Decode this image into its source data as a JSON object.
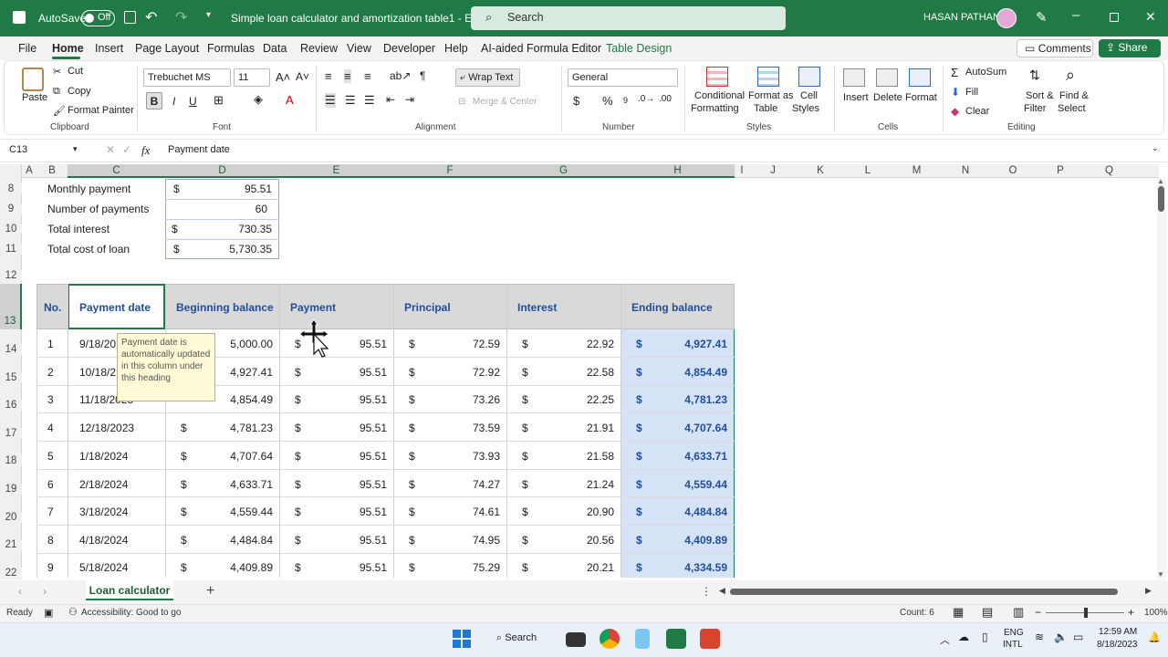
{
  "titlebar": {
    "autosave_label": "AutoSave",
    "autosave_state": "Off",
    "doc_title": "Simple loan calculator and amortization table1 - E...",
    "search_label": "Search",
    "user_name": "HASAN PATHAN"
  },
  "menu": {
    "tabs": [
      "File",
      "Home",
      "Insert",
      "Page Layout",
      "Formulas",
      "Data",
      "Review",
      "View",
      "Developer",
      "Help",
      "AI-aided Formula Editor",
      "Table Design"
    ],
    "comments_label": "Comments",
    "share_label": "Share"
  },
  "ribbon": {
    "clipboard": {
      "paste": "Paste",
      "cut": "Cut",
      "copy": "Copy",
      "format_painter": "Format Painter",
      "group": "Clipboard"
    },
    "font": {
      "name": "Trebuchet MS",
      "size": "11",
      "bold": "B",
      "italic": "I",
      "underline": "U",
      "group": "Font"
    },
    "alignment": {
      "wrap_text": "Wrap Text",
      "merge_center": "Merge & Center",
      "group": "Alignment"
    },
    "number": {
      "format": "General",
      "currency": "$",
      "percent": "%",
      "group": "Number"
    },
    "styles": {
      "conditional_1": "Conditional",
      "conditional_2": "Formatting",
      "format_table_1": "Format as",
      "format_table_2": "Table",
      "cell_styles_1": "Cell",
      "cell_styles_2": "Styles",
      "group": "Styles"
    },
    "cells": {
      "insert": "Insert",
      "delete": "Delete",
      "format": "Format",
      "group": "Cells"
    },
    "editing": {
      "autosum": "AutoSum",
      "fill": "Fill",
      "clear": "Clear",
      "sort_1": "Sort &",
      "sort_2": "Filter",
      "find_1": "Find &",
      "find_2": "Select",
      "group": "Editing"
    }
  },
  "formula_bar": {
    "name_box": "C13",
    "fx": "fx",
    "content": "Payment date"
  },
  "columns": [
    "A",
    "B",
    "C",
    "D",
    "E",
    "F",
    "G",
    "H",
    "I",
    "J",
    "K",
    "L",
    "M",
    "N",
    "O",
    "P",
    "Q"
  ],
  "rows": [
    "8",
    "9",
    "10",
    "11",
    "12",
    "13",
    "14",
    "15",
    "16",
    "17",
    "18",
    "19",
    "20",
    "21",
    "22"
  ],
  "summary": [
    {
      "label": "Monthly payment",
      "currency": "$",
      "value": "95.51"
    },
    {
      "label": "Number of payments",
      "currency": "",
      "value": "60"
    },
    {
      "label": "Total interest",
      "currency": "$",
      "value": "730.35"
    },
    {
      "label": "Total cost of loan",
      "currency": "$",
      "value": "5,730.35"
    }
  ],
  "table": {
    "headers": [
      "No.",
      "Payment date",
      "Beginning balance",
      "Payment",
      "Principal",
      "Interest",
      "Ending balance"
    ],
    "currency": "$",
    "rows": [
      {
        "no": "1",
        "date": "9/18/20",
        "begin": "5,000.00",
        "payment": "95.51",
        "principal": "72.59",
        "interest": "22.92",
        "end": "4,927.41"
      },
      {
        "no": "2",
        "date": "10/18/2",
        "begin": "4,927.41",
        "payment": "95.51",
        "principal": "72.92",
        "interest": "22.58",
        "end": "4,854.49"
      },
      {
        "no": "3",
        "date": "11/18/2023",
        "begin": "4,854.49",
        "payment": "95.51",
        "principal": "73.26",
        "interest": "22.25",
        "end": "4,781.23"
      },
      {
        "no": "4",
        "date": "12/18/2023",
        "begin": "4,781.23",
        "payment": "95.51",
        "principal": "73.59",
        "interest": "21.91",
        "end": "4,707.64"
      },
      {
        "no": "5",
        "date": "1/18/2024",
        "begin": "4,707.64",
        "payment": "95.51",
        "principal": "73.93",
        "interest": "21.58",
        "end": "4,633.71"
      },
      {
        "no": "6",
        "date": "2/18/2024",
        "begin": "4,633.71",
        "payment": "95.51",
        "principal": "74.27",
        "interest": "21.24",
        "end": "4,559.44"
      },
      {
        "no": "7",
        "date": "3/18/2024",
        "begin": "4,559.44",
        "payment": "95.51",
        "principal": "74.61",
        "interest": "20.90",
        "end": "4,484.84"
      },
      {
        "no": "8",
        "date": "4/18/2024",
        "begin": "4,484.84",
        "payment": "95.51",
        "principal": "74.95",
        "interest": "20.56",
        "end": "4,409.89"
      },
      {
        "no": "9",
        "date": "5/18/2024",
        "begin": "4,409.89",
        "payment": "95.51",
        "principal": "75.29",
        "interest": "20.21",
        "end": "4,334.59"
      }
    ]
  },
  "tooltip": "Payment date is automatically updated in this column under this heading",
  "sheet": {
    "tab": "Loan calculator",
    "add": "+"
  },
  "status": {
    "ready": "Ready",
    "accessibility": "Accessibility: Good to go",
    "count": "Count: 6",
    "zoom": "100%"
  },
  "taskbar": {
    "search": "Search",
    "lang_1": "ENG",
    "lang_2": "INTL",
    "time": "12:59 AM",
    "date": "8/18/2023"
  },
  "colors": {
    "excel_green": "#1f7a45",
    "header_blue": "#1f4e9c",
    "highlight": "#d6e2f5"
  }
}
